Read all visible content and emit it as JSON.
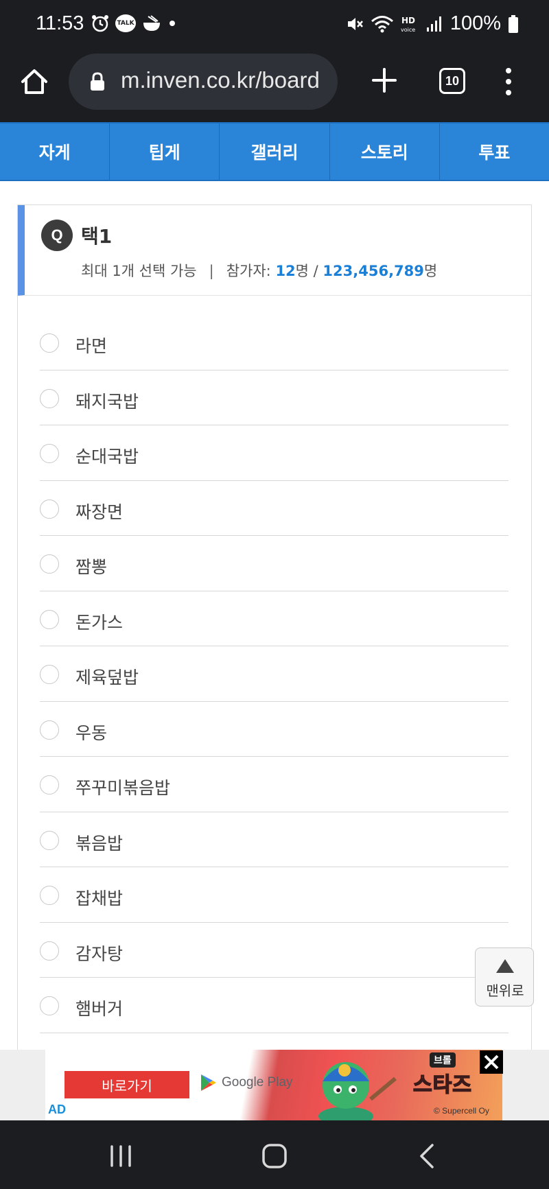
{
  "status_bar": {
    "time": "11:53",
    "battery": "100%",
    "talk_badge": "TALK",
    "icons": [
      "alarm-icon",
      "talk-icon",
      "bowl-icon",
      "dot-icon",
      "mute-icon",
      "wifi-icon",
      "hd-voice-icon",
      "signal-icon",
      "battery-icon"
    ]
  },
  "browser": {
    "url": "m.inven.co.kr/board",
    "tab_count": "10"
  },
  "nav_tabs": [
    "자게",
    "팁게",
    "갤러리",
    "스토리",
    "투표"
  ],
  "poll": {
    "badge": "Q",
    "title": "택1",
    "select_info": "최대 1개 선택 가능",
    "separator": "|",
    "participants_label": "참가자: ",
    "participants_count": "12",
    "participants_unit1": "명 / ",
    "participants_total": "123,456,789",
    "participants_unit2": "명",
    "options": [
      "라면",
      "돼지국밥",
      "순대국밥",
      "짜장면",
      "짬뽕",
      "돈가스",
      "제육덮밥",
      "우동",
      "쭈꾸미볶음밥",
      "볶음밥",
      "잡채밥",
      "감자탕",
      "햄버거"
    ]
  },
  "scroll_top": {
    "label": "맨위로"
  },
  "ad": {
    "go_button": "바로가기",
    "store": "Google Play",
    "logo_top": "브롤",
    "logo": "스타즈",
    "copyright": "© Supercell Oy",
    "label": "AD"
  },
  "colors": {
    "nav_blue": "#2a84d8",
    "accent_blue": "#1a7fd6",
    "header_bar": "#5a93e6",
    "ad_red": "#e53935"
  }
}
